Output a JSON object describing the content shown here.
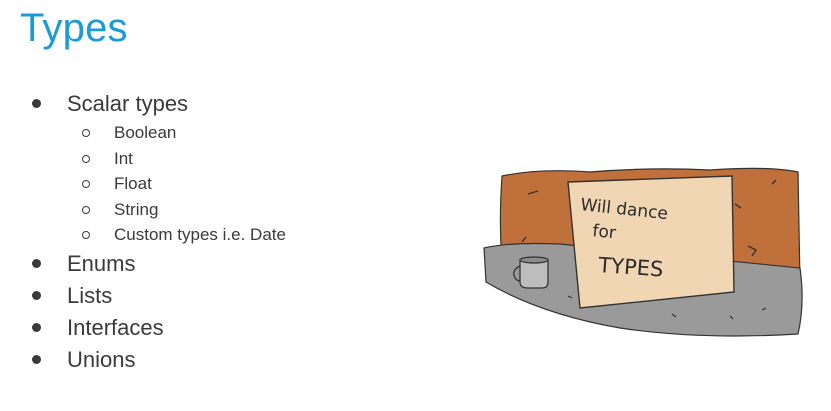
{
  "slide": {
    "title": "Types",
    "bullets": [
      {
        "label": "Scalar types",
        "sub": [
          "Boolean",
          "Int",
          "Float",
          "String",
          "Custom types i.e. Date"
        ]
      },
      {
        "label": "Enums"
      },
      {
        "label": "Lists"
      },
      {
        "label": "Interfaces"
      },
      {
        "label": "Unions"
      }
    ],
    "illustration": {
      "sign_line1": "Will dance",
      "sign_line2": "for",
      "sign_line3": "TYPES"
    }
  },
  "colors": {
    "title": "#1a9bd7",
    "text": "#3a3a3a",
    "wall": "#c0703a",
    "ground": "#9a9a9a",
    "sign": "#f1d6b3"
  }
}
